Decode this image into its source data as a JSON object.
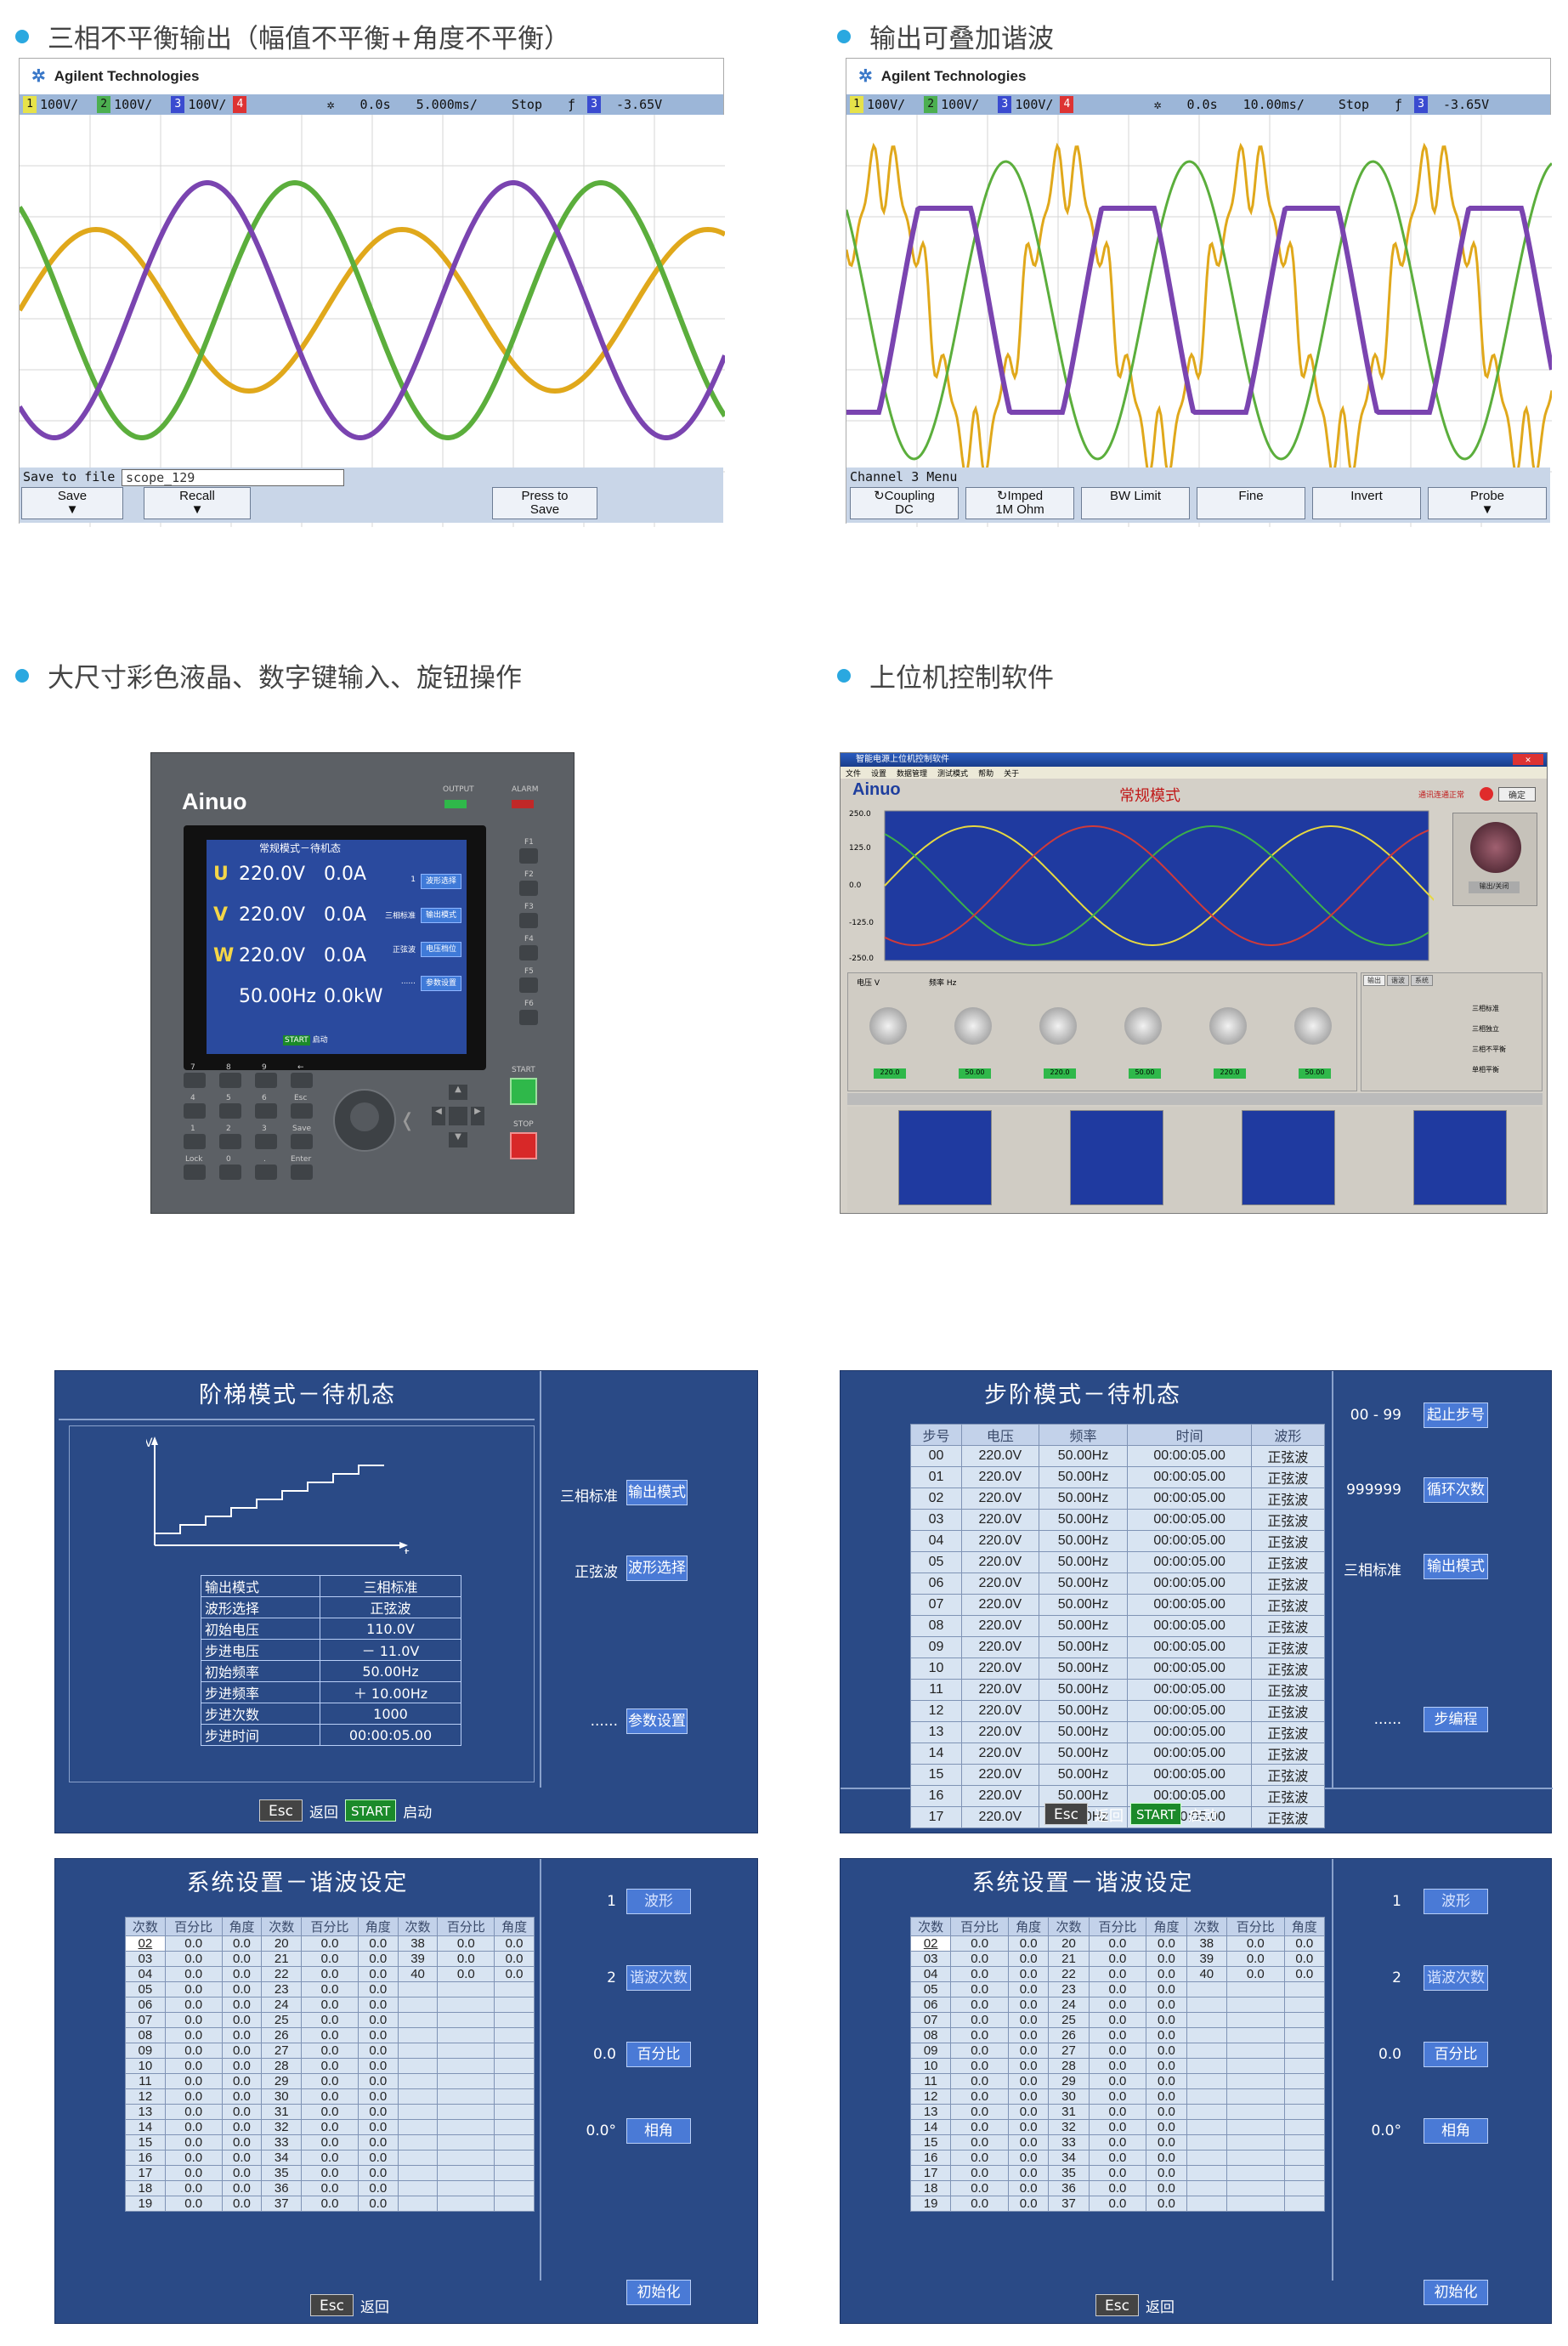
{
  "sections": {
    "s1": "三相不平衡输出（幅值不平衡+角度不平衡）",
    "s2": "输出可叠加谐波",
    "s3": "大尺寸彩色液晶、数字键输入、旋钮操作",
    "s4": "上位机控制软件"
  },
  "scope1": {
    "brand": "Agilent Technologies",
    "ch": [
      "1",
      "2",
      "3",
      "4"
    ],
    "ch_vals": [
      "100V/",
      "100V/",
      "100V/"
    ],
    "time": "0.0s",
    "timebase": "5.000ms/",
    "mode": "Stop",
    "trig_ch": "3",
    "trig_val": "-3.65V",
    "save_label": "Save to file =",
    "save_value": "scope_129",
    "buttons": [
      "Save",
      "Recall",
      "Press to\nSave"
    ]
  },
  "scope2": {
    "brand": "Agilent Technologies",
    "ch": [
      "1",
      "2",
      "3",
      "4"
    ],
    "ch_vals": [
      "100V/",
      "100V/",
      "100V/"
    ],
    "time": "0.0s",
    "timebase": "10.00ms/",
    "mode": "Stop",
    "trig_ch": "3",
    "trig_val": "-3.65V",
    "menu_label": "Channel 3  Menu",
    "buttons": [
      "Coupling\nDC",
      "Imped\n1M Ohm",
      "BW Limit",
      "Fine",
      "Invert",
      "Probe"
    ]
  },
  "device": {
    "logo": "Ainuo",
    "output_label": "OUTPUT",
    "alarm_label": "ALARM",
    "lcd_title": "常规模式－待机态",
    "rows": [
      {
        "ph": "U",
        "v": "220.0V",
        "a": "0.0A"
      },
      {
        "ph": "V",
        "v": "220.0V",
        "a": "0.0A"
      },
      {
        "ph": "W",
        "v": "220.0V",
        "a": "0.0A"
      }
    ],
    "freq": "50.00Hz",
    "power": "0.0kW",
    "start_label": "START",
    "start_sub": "启动",
    "side_btns": [
      "波形选择",
      "输出模式",
      "电压档位",
      "参数设置"
    ],
    "side_labs": [
      "1",
      "三相标准",
      "正弦波",
      "......"
    ],
    "start_key": "START",
    "stop_key": "STOP",
    "fkeys": [
      "F1",
      "F2",
      "F3",
      "F4",
      "F5",
      "F6"
    ],
    "keypad": [
      "7",
      "8",
      "9",
      "←",
      "4",
      "5",
      "6",
      "Esc",
      "1",
      "2",
      "3",
      "Save",
      "Lock",
      "0",
      ".",
      "Enter"
    ]
  },
  "app": {
    "title": "智能电源上位机控制软件",
    "menu": [
      "文件",
      "设置",
      "数据管理",
      "测试模式",
      "帮助",
      "关于"
    ],
    "logo": "Ainuo",
    "mode": "常规模式",
    "status": "通讯连通正常",
    "ok": "确定",
    "yticks": [
      "250.0",
      "125.0",
      "0.0",
      "-125.0",
      "-250.0"
    ],
    "knob_labels": [
      "电压 V",
      "频率 Hz"
    ],
    "knob_vals": [
      "220.0",
      "50.00",
      "220.0",
      "50.00",
      "220.0",
      "50.00"
    ],
    "tabs": [
      "输出",
      "谐波",
      "系统"
    ],
    "output_btn": "输出/关闭",
    "modes": [
      "三相标准",
      "三相独立",
      "三相不平衡",
      "单相平衡"
    ]
  },
  "ladder": {
    "title": "阶梯模式－待机态",
    "axis_v": "V",
    "axis_t": "t",
    "params": [
      [
        "输出模式",
        "三相标准"
      ],
      [
        "波形选择",
        "正弦波"
      ],
      [
        "初始电压",
        "110.0V"
      ],
      [
        "步进电压",
        "－ 11.0V"
      ],
      [
        "初始频率",
        "50.00Hz"
      ],
      [
        "步进频率",
        "＋ 10.00Hz"
      ],
      [
        "步进次数",
        "1000"
      ],
      [
        "步进时间",
        "00:00:05.00"
      ]
    ],
    "side": [
      {
        "lab": "三相标准",
        "btn": "输出模式"
      },
      {
        "lab": "正弦波",
        "btn": "波形选择"
      },
      {
        "lab": "......",
        "btn": "参数设置"
      }
    ],
    "esc": "Esc",
    "esc_label": "返回",
    "start": "START",
    "start_label": "启动"
  },
  "step": {
    "title": "步阶模式－待机态",
    "headers": [
      "步号",
      "电压",
      "频率",
      "时间",
      "波形"
    ],
    "rows": [
      [
        "00",
        "220.0V",
        "50.00Hz",
        "00:00:05.00",
        "正弦波"
      ],
      [
        "01",
        "220.0V",
        "50.00Hz",
        "00:00:05.00",
        "正弦波"
      ],
      [
        "02",
        "220.0V",
        "50.00Hz",
        "00:00:05.00",
        "正弦波"
      ],
      [
        "03",
        "220.0V",
        "50.00Hz",
        "00:00:05.00",
        "正弦波"
      ],
      [
        "04",
        "220.0V",
        "50.00Hz",
        "00:00:05.00",
        "正弦波"
      ],
      [
        "05",
        "220.0V",
        "50.00Hz",
        "00:00:05.00",
        "正弦波"
      ],
      [
        "06",
        "220.0V",
        "50.00Hz",
        "00:00:05.00",
        "正弦波"
      ],
      [
        "07",
        "220.0V",
        "50.00Hz",
        "00:00:05.00",
        "正弦波"
      ],
      [
        "08",
        "220.0V",
        "50.00Hz",
        "00:00:05.00",
        "正弦波"
      ],
      [
        "09",
        "220.0V",
        "50.00Hz",
        "00:00:05.00",
        "正弦波"
      ],
      [
        "10",
        "220.0V",
        "50.00Hz",
        "00:00:05.00",
        "正弦波"
      ],
      [
        "11",
        "220.0V",
        "50.00Hz",
        "00:00:05.00",
        "正弦波"
      ],
      [
        "12",
        "220.0V",
        "50.00Hz",
        "00:00:05.00",
        "正弦波"
      ],
      [
        "13",
        "220.0V",
        "50.00Hz",
        "00:00:05.00",
        "正弦波"
      ],
      [
        "14",
        "220.0V",
        "50.00Hz",
        "00:00:05.00",
        "正弦波"
      ],
      [
        "15",
        "220.0V",
        "50.00Hz",
        "00:00:05.00",
        "正弦波"
      ],
      [
        "16",
        "220.0V",
        "50.00Hz",
        "00:00:05.00",
        "正弦波"
      ],
      [
        "17",
        "220.0V",
        "50.00Hz",
        "00:00:05.00",
        "正弦波"
      ]
    ],
    "side": [
      {
        "lab": "00 - 99",
        "btn": "起止步号"
      },
      {
        "lab": "999999",
        "btn": "循环次数"
      },
      {
        "lab": "三相标准",
        "btn": "输出模式"
      },
      {
        "lab": "......",
        "btn": "步编程"
      }
    ],
    "esc": "Esc",
    "esc_label": "返回",
    "start": "START",
    "start_label": "启动"
  },
  "harm": {
    "title": "系统设置－谐波设定",
    "headers": [
      "次数",
      "百分比",
      "角度",
      "次数",
      "百分比",
      "角度",
      "次数",
      "百分比",
      "角度"
    ],
    "col1": [
      "02",
      "03",
      "04",
      "05",
      "06",
      "07",
      "08",
      "09",
      "10",
      "11",
      "12",
      "13",
      "14",
      "15",
      "16",
      "17",
      "18",
      "19"
    ],
    "col2": [
      "20",
      "21",
      "22",
      "23",
      "24",
      "25",
      "26",
      "27",
      "28",
      "29",
      "30",
      "31",
      "32",
      "33",
      "34",
      "35",
      "36",
      "37"
    ],
    "col3": [
      "38",
      "39",
      "40"
    ],
    "zero": "0.0",
    "side": [
      {
        "lab": "1",
        "btn": "波形"
      },
      {
        "lab": "2",
        "btn": "谐波次数"
      },
      {
        "lab": "0.0",
        "btn": "百分比"
      },
      {
        "lab": "0.0°",
        "btn": "相角"
      },
      {
        "lab": "",
        "btn": "初始化"
      }
    ],
    "esc": "Esc",
    "esc_label": "返回"
  }
}
